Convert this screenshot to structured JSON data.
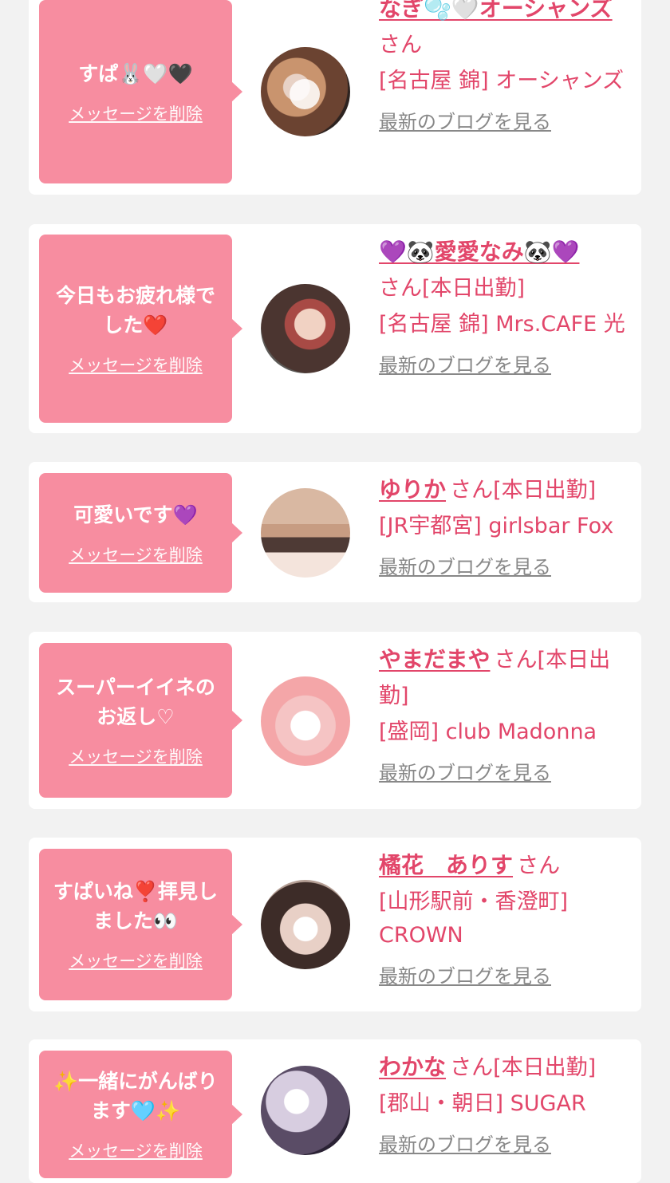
{
  "delete_label": "メッセージを削除",
  "blog_label": "最新のブログを見る",
  "colors": {
    "accent": "#e2466a",
    "bubble": "#f78da0",
    "background": "#f2f2f2"
  },
  "items": [
    {
      "message": "すぱ🐰🤍🖤",
      "name": "なぎ🫧🤍オーシャンズ",
      "suffix": "さん",
      "shop": "[名古屋 錦] オーシャンズ"
    },
    {
      "message": "今日もお疲れ様でした❤️",
      "name": "💜🐼愛愛なみ🐼💜",
      "suffix": "さん[本日出勤]",
      "shop": "[名古屋 錦] Mrs.CAFE 光"
    },
    {
      "message": "可愛いです💜",
      "name": "ゆりか",
      "suffix": "さん[本日出勤]",
      "shop": "[JR宇都宮] girlsbar Fox"
    },
    {
      "message": "スーパーイイネのお返し♡",
      "name": "やまだまや",
      "suffix": "さん[本日出勤]",
      "shop": "[盛岡] club Madonna"
    },
    {
      "message": "すぱいね❣️拝見しました👀",
      "name": "橘花　ありす",
      "suffix": "さん",
      "shop": "[山形駅前・香澄町] CROWN"
    },
    {
      "message": "✨一緒にがんばります🩵✨",
      "name": "わかな",
      "suffix": "さん[本日出勤]",
      "shop": "[郡山・朝日] SUGAR"
    }
  ]
}
